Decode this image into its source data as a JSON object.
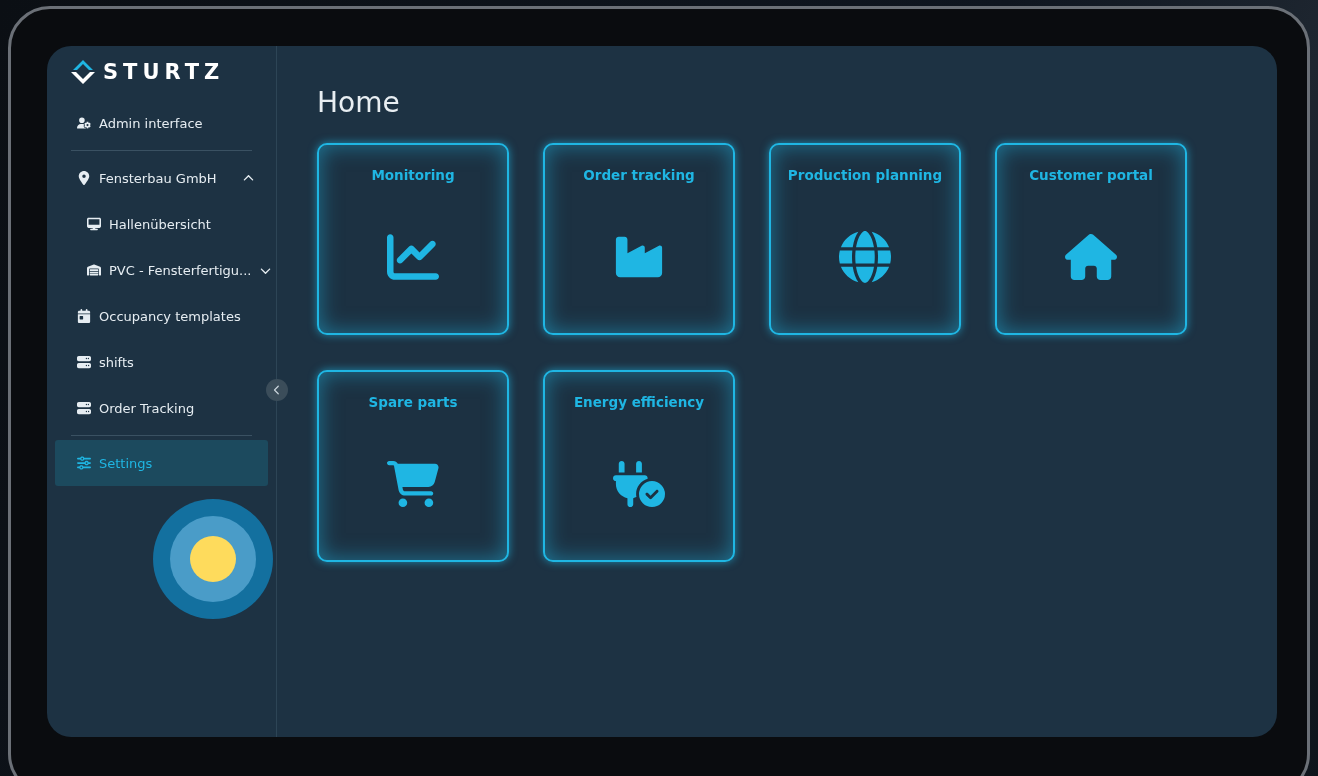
{
  "logo": "STURTZ",
  "sidebar": {
    "sections": [
      [
        {
          "label": "Admin interface",
          "selected": false
        }
      ],
      [
        {
          "label": "Fensterbau GmbH",
          "selected": false,
          "expanded": true,
          "children": [
            {
              "label": "Hallenübersicht",
              "selected": false
            },
            {
              "label": "PVC - Fensterfertigu...",
              "selected": false,
              "expanded": false
            }
          ]
        },
        {
          "label": "Occupancy templates",
          "selected": false
        },
        {
          "label": "shifts",
          "selected": false
        },
        {
          "label": "Order Tracking",
          "selected": false
        }
      ],
      [
        {
          "label": "Settings",
          "selected": true
        }
      ]
    ]
  },
  "page_title": "Home",
  "tiles": [
    {
      "label": "Monitoring"
    },
    {
      "label": "Order tracking"
    },
    {
      "label": "Production planning"
    },
    {
      "label": "Customer portal"
    },
    {
      "label": "Spare parts"
    },
    {
      "label": "Energy efficiency"
    }
  ]
}
